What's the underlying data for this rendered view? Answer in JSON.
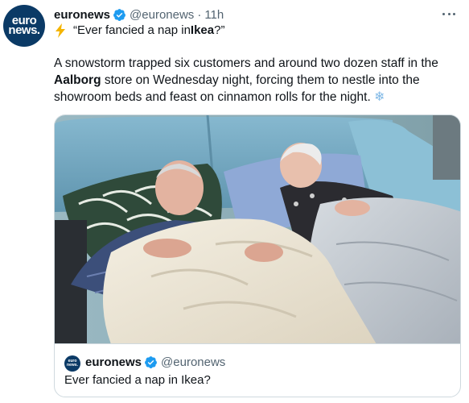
{
  "tweet": {
    "avatar": {
      "line1": "euro",
      "line2": "news."
    },
    "author_name": "euronews",
    "handle": "@euronews",
    "separator": "·",
    "time": "11h",
    "headline_pre": "“Ever fancied a nap in ",
    "headline_bold": "Ikea",
    "headline_post": "?”",
    "body_1": "A snowstorm trapped six customers and around two dozen staff in the ",
    "body_bold": "Aalborg",
    "body_2": " store on Wednesday night, forcing them to nestle into the showroom beds and feast on cinnamon rolls for the night. ",
    "body_emoji": "❄",
    "icons": [
      "verified-badge-icon",
      "lightning-bolt-icon",
      "more-options-icon",
      "snowflake-icon"
    ],
    "colors": {
      "verified": "#1d9bf0",
      "brand": "#0b3a66",
      "muted": "#536471",
      "bolt": "#f4b400"
    }
  },
  "quote": {
    "avatar": {
      "line1": "euro",
      "line2": "news."
    },
    "author_name": "euronews",
    "handle": "@euronews",
    "text": "Ever fancied a nap in Ikea?"
  }
}
